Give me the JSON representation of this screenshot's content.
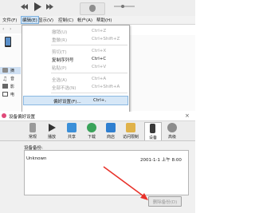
{
  "menubar": {
    "items": [
      "文件(F)",
      "编辑(E)",
      "显示(V)",
      "控制(C)",
      "帐户(A)",
      "帮助(H)"
    ],
    "active_index": 1
  },
  "edit_menu": {
    "items": [
      {
        "label": "撤销(U)",
        "shortcut": "Ctrl+Z",
        "disabled": true
      },
      {
        "label": "重做(R)",
        "shortcut": "Ctrl+Shift+Z",
        "disabled": true
      },
      {
        "label": "剪切(T)",
        "shortcut": "Ctrl+X",
        "disabled": true
      },
      {
        "label": "复制序列号",
        "shortcut": "Ctrl+C",
        "disabled": false
      },
      {
        "label": "粘贴(P)",
        "shortcut": "Ctrl+V",
        "disabled": true
      },
      {
        "label": "全选(A)",
        "shortcut": "Ctrl+A",
        "disabled": true
      },
      {
        "label": "全部不选(N)",
        "shortcut": "Ctrl+Shift+A",
        "disabled": true
      },
      {
        "label": "偏好设置(F)...",
        "shortcut": "Ctrl+,",
        "disabled": false
      }
    ]
  },
  "sidebar": {
    "items": [
      {
        "icon": "settings-icon",
        "label": "摘"
      },
      {
        "icon": "music-icon",
        "label": "音"
      },
      {
        "icon": "film-icon",
        "label": "影"
      },
      {
        "icon": "tv-icon",
        "label": "电"
      }
    ]
  },
  "dialog": {
    "title": "设备偏好设置",
    "tabs": [
      {
        "icon": "phone-icon",
        "label": "常规"
      },
      {
        "icon": "play-icon",
        "label": "播放"
      },
      {
        "icon": "share-icon",
        "label": "共享"
      },
      {
        "icon": "download-icon",
        "label": "下载"
      },
      {
        "icon": "store-icon",
        "label": "商店"
      },
      {
        "icon": "parental-icon",
        "label": "访问限制"
      },
      {
        "icon": "device-icon",
        "label": "设备"
      },
      {
        "icon": "gear-icon",
        "label": "高级"
      }
    ],
    "selected_tab": 6,
    "section_label": "设备备份:",
    "backup": {
      "name": "Unknown",
      "date": "2001-1-1 上午 8:00"
    },
    "delete_button": "删除备份(D)"
  },
  "colors": {
    "highlight": "#d6e7f7",
    "arrow": "#e8322a"
  }
}
